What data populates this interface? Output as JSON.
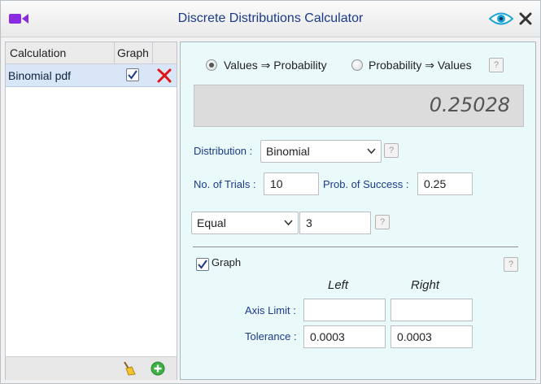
{
  "window": {
    "title": "Discrete Distributions Calculator"
  },
  "colors": {
    "title_text": "#1b3a8a",
    "accent_purple": "#8a2be2",
    "selected_row": "#d8e6f8",
    "panel_bg": "#eafafa"
  },
  "left_panel": {
    "columns": [
      "Calculation",
      "Graph"
    ],
    "rows": [
      {
        "label": "Binomial pdf",
        "graph_checked": true
      }
    ]
  },
  "modes": {
    "option1": "Values ⇒ Probability",
    "option2": "Probability ⇒ Values",
    "selected": "option1"
  },
  "result": "0.25028",
  "distribution": {
    "label": "Distribution :",
    "value": "Binomial"
  },
  "trials": {
    "label": "No. of Trials :",
    "value": "10"
  },
  "success": {
    "label": "Prob. of Success :",
    "value": "0.25"
  },
  "condition": {
    "value": "Equal",
    "input": "3"
  },
  "graph": {
    "label": "Graph",
    "checked": true,
    "col_left": "Left",
    "col_right": "Right",
    "axis_label": "Axis Limit :",
    "axis_left": "",
    "axis_right": "",
    "tolerance_label": "Tolerance :",
    "tol_left": "0.0003",
    "tol_right": "0.0003"
  },
  "help_text": "?"
}
